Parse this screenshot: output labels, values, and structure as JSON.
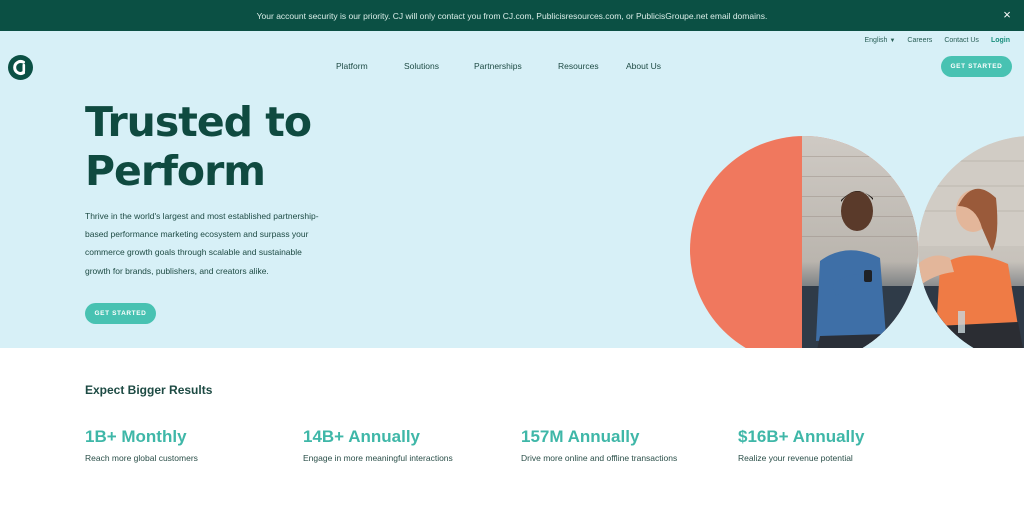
{
  "banner": {
    "text": "Your account security is our priority. CJ will only contact you from CJ.com, Publicisresources.com, or PublicisGroupe.net email domains.",
    "close_label": "×"
  },
  "utility_nav": {
    "language": "English",
    "careers": "Careers",
    "contact": "Contact Us",
    "login": "Login"
  },
  "main_nav": [
    "Platform",
    "Solutions",
    "Partnerships",
    "Resources",
    "About Us"
  ],
  "header_cta": "GET STARTED",
  "hero": {
    "headline_line1": "Trusted to",
    "headline_line2": "Perform",
    "body": "Thrive in the world's largest and most established partnership-based performance marketing ecosystem and surpass your commerce growth goals through scalable and sustainable growth for brands, publishers, and creators alike.",
    "cta": "GET STARTED"
  },
  "results": {
    "title": "Expect Bigger Results",
    "stats": [
      {
        "value": "1B+ Monthly",
        "desc": "Reach more global customers"
      },
      {
        "value": "14B+ Annually",
        "desc": "Engage in more meaningful interactions"
      },
      {
        "value": "157M Annually",
        "desc": "Drive more online and offline transactions"
      },
      {
        "value": "$16B+ Annually",
        "desc": "Realize your revenue potential"
      }
    ]
  },
  "colors": {
    "banner": "#0b5044",
    "hero_bg": "#d7f0f7",
    "accent": "#48c2b2",
    "coral": "#f0785e",
    "stat_value": "#3fb7a8"
  },
  "icons": {
    "logo": "cj-logo-icon",
    "close": "close-icon",
    "caret": "chevron-down-icon"
  }
}
